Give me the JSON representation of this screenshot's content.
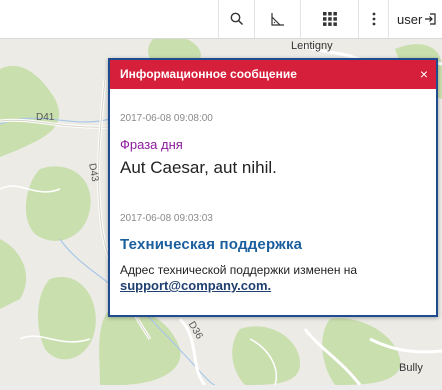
{
  "toolbar": {
    "icons": [
      "search-icon",
      "measure-icon",
      "grid-apps-icon",
      "more-vert-icon",
      "login-icon"
    ],
    "user_label": "user"
  },
  "map": {
    "labels": {
      "top_town": "Lentigny",
      "road_d41": "D41",
      "road_d43": "D43",
      "road_d36": "D36",
      "bottom_town": "Bully"
    }
  },
  "popup": {
    "title": "Информационное сообщение",
    "close_glyph": "×",
    "messages": [
      {
        "date": "2017-06-08 09:08:00",
        "title": "Фраза дня",
        "body": "Aut Caesar, aut nihil."
      },
      {
        "date": "2017-06-08 09:03:03",
        "title": "Техническая поддержка",
        "body": "Адрес технической поддержки изменен на",
        "link": "support@company.com."
      }
    ]
  },
  "colors": {
    "header_red": "#d61f3b",
    "border_blue": "#1f4c8f",
    "title_purple": "#8b1a9b",
    "title_blue": "#1b5f9e"
  }
}
